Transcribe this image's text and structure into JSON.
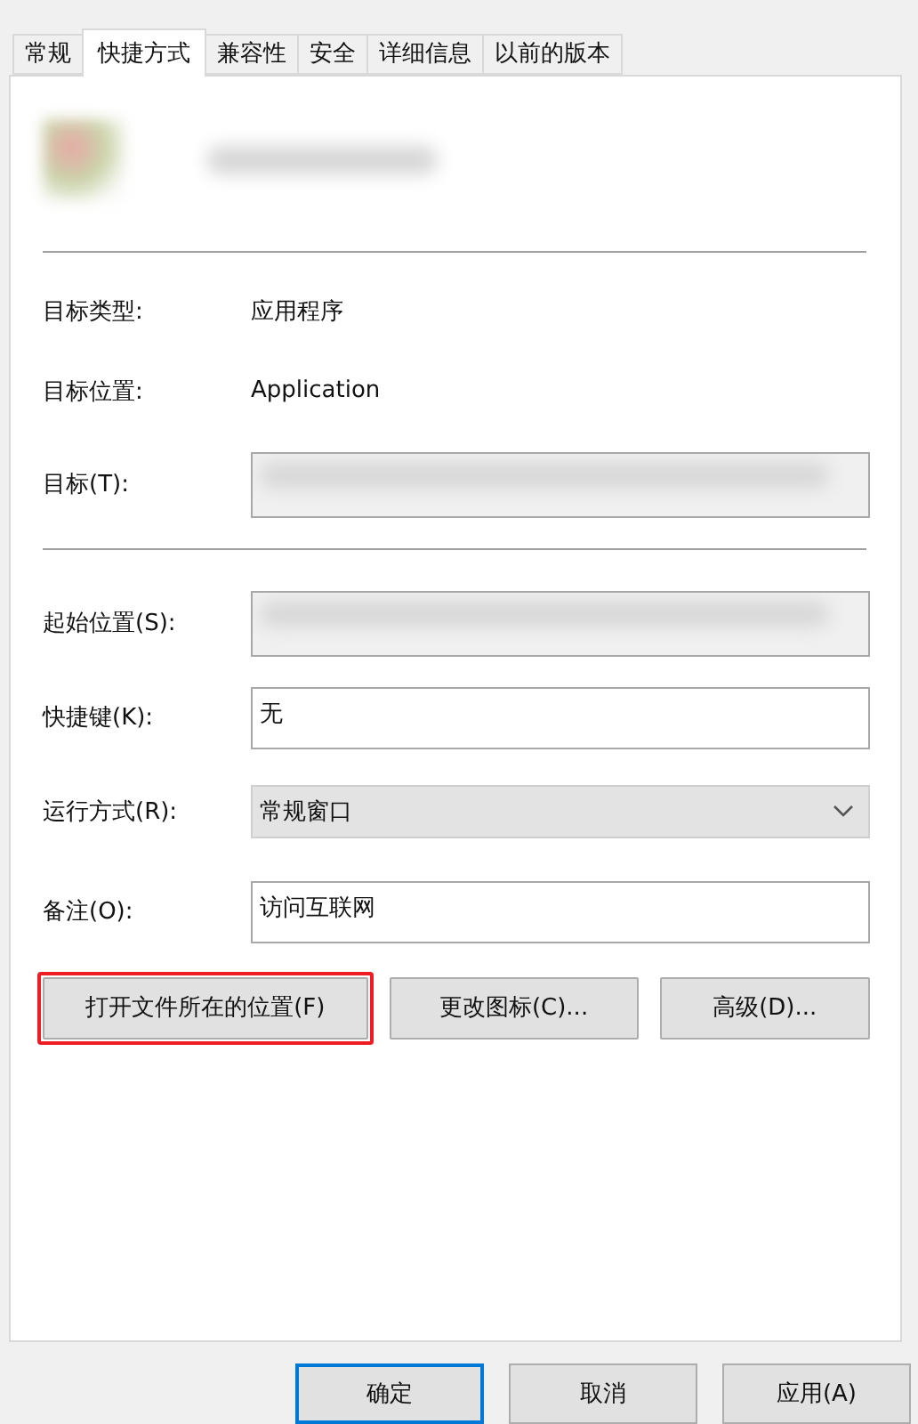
{
  "tabs": [
    {
      "label": "常规",
      "selected": false
    },
    {
      "label": "快捷方式",
      "selected": true
    },
    {
      "label": "兼容性",
      "selected": false
    },
    {
      "label": "安全",
      "selected": false
    },
    {
      "label": "详细信息",
      "selected": false
    },
    {
      "label": "以前的版本",
      "selected": false
    }
  ],
  "header": {
    "kind": "redacted"
  },
  "info_rows": [
    {
      "label": "目标类型:",
      "value": "应用程序"
    },
    {
      "label": "目标位置:",
      "value": "Application"
    }
  ],
  "target": {
    "label": "目标(T):",
    "kind": "redacted"
  },
  "fields": [
    {
      "label": "起始位置(S):",
      "kind": "redacted"
    },
    {
      "label": "快捷键(K):",
      "kind": "text",
      "value": "无"
    },
    {
      "label": "运行方式(R):",
      "kind": "select",
      "value": "常规窗口"
    },
    {
      "label": "备注(O):",
      "kind": "text",
      "value": "访问互联网"
    }
  ],
  "actions": [
    {
      "label": "打开文件所在的位置(F)",
      "highlighted": true
    },
    {
      "label": "更改图标(C)...",
      "highlighted": false
    },
    {
      "label": "高级(D)...",
      "highlighted": false
    }
  ],
  "buttons": [
    {
      "label": "确定",
      "default": true
    },
    {
      "label": "取消",
      "default": false
    },
    {
      "label": "应用(A)",
      "default": false
    }
  ]
}
